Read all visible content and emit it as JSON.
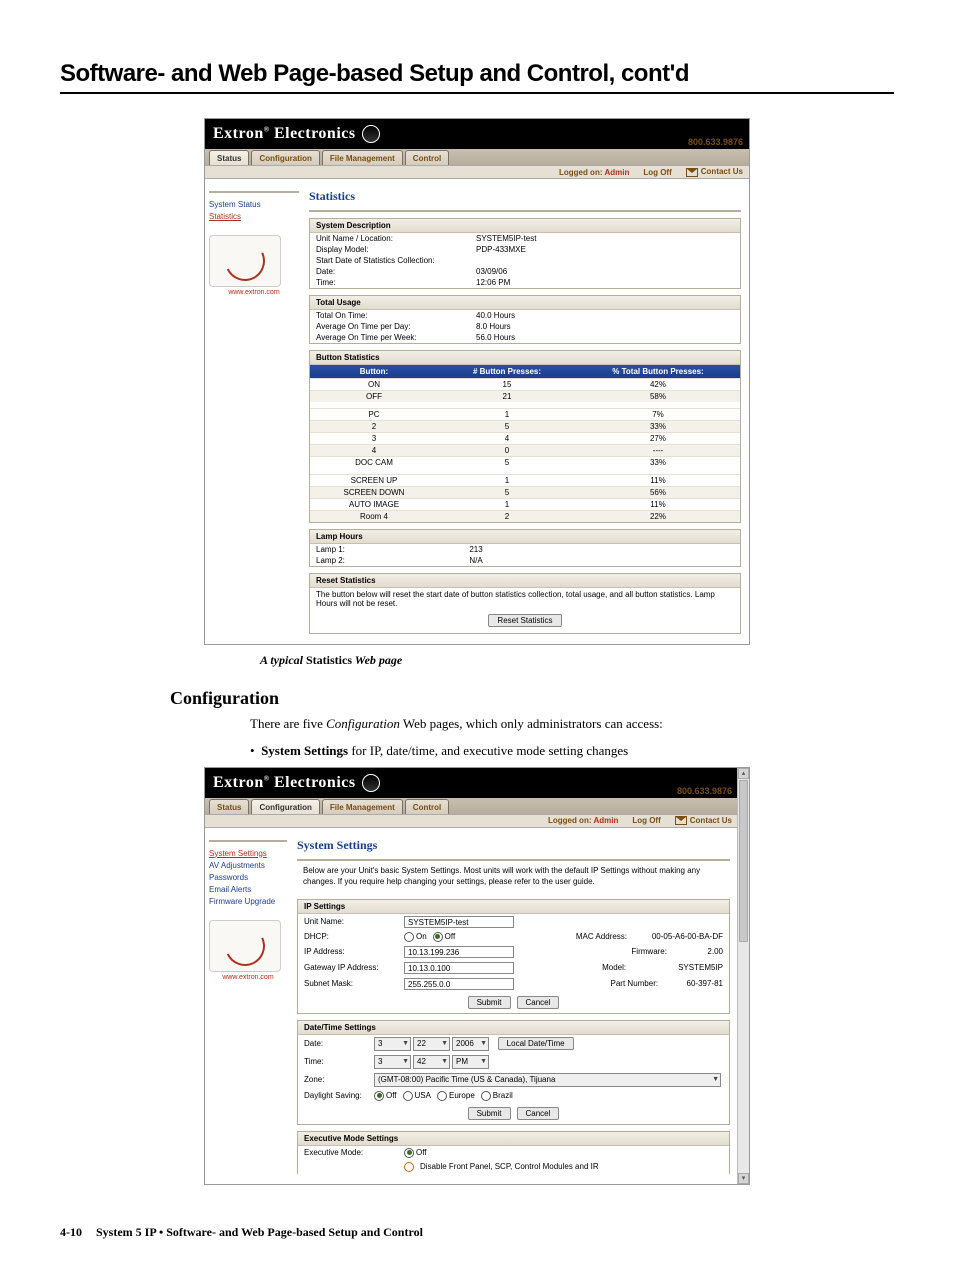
{
  "page": {
    "title": "Software- and Web Page-based Setup and Control, cont'd",
    "footer_page": "4-10",
    "footer_text": "System 5 IP • Software- and Web Page-based Setup and Control"
  },
  "caption1_a": "A typical",
  "caption1_b": "Statistics",
  "caption1_c": "Web page",
  "section_heading": "Configuration",
  "para1_a": "There are five ",
  "para1_ital": "Configuration",
  "para1_b": " Web pages, which only administrators can access:",
  "bullet1_b": "System Settings",
  "bullet1_rest": " for IP, date/time, and executive mode setting changes",
  "brand": {
    "extron": "Extron",
    "electronics": "Electronics",
    "phone": "800.633.9876",
    "logged_label": "Logged on:",
    "logged_user": "Admin",
    "logoff": "Log Off",
    "contact": "Contact Us",
    "url": "www.extron.com"
  },
  "tabs": [
    "Status",
    "Configuration",
    "File Management",
    "Control"
  ],
  "stats": {
    "heading": "Statistics",
    "side_links": [
      "System Status",
      "Statistics"
    ],
    "sys_desc_h": "System Description",
    "sys_desc": {
      "unit_k": "Unit Name / Location:",
      "unit_v": "SYSTEM5IP-test",
      "disp_k": "Display Model:",
      "disp_v": "PDP-433MXE",
      "start_k": "Start Date of Statistics Collection:",
      "start_v": "",
      "date_k": "Date:",
      "date_v": "03/09/06",
      "time_k": "Time:",
      "time_v": "12:06 PM"
    },
    "usage_h": "Total Usage",
    "usage": {
      "tot_k": "Total On Time:",
      "tot_v": "40.0 Hours",
      "day_k": "Average On Time per Day:",
      "day_v": "8.0   Hours",
      "week_k": "Average On Time per Week:",
      "week_v": "56.0 Hours"
    },
    "btn_h": "Button Statistics",
    "btn_cols": {
      "b": "Button:",
      "p": "# Button Presses:",
      "t": "% Total Button Presses:"
    },
    "btn_rows": [
      {
        "b": "ON",
        "p": "15",
        "t": "42%"
      },
      {
        "b": "OFF",
        "p": "21",
        "t": "58%"
      }
    ],
    "btn_rows2": [
      {
        "b": "PC",
        "p": "1",
        "t": "7%"
      },
      {
        "b": "2",
        "p": "5",
        "t": "33%"
      },
      {
        "b": "3",
        "p": "4",
        "t": "27%"
      },
      {
        "b": "4",
        "p": "0",
        "t": "----"
      },
      {
        "b": "DOC CAM",
        "p": "5",
        "t": "33%"
      }
    ],
    "btn_rows3": [
      {
        "b": "SCREEN UP",
        "p": "1",
        "t": "11%"
      },
      {
        "b": "SCREEN DOWN",
        "p": "5",
        "t": "56%"
      },
      {
        "b": "AUTO IMAGE",
        "p": "1",
        "t": "11%"
      },
      {
        "b": "Room 4",
        "p": "2",
        "t": "22%"
      }
    ],
    "lamp_h": "Lamp Hours",
    "lamp": {
      "l1_k": "Lamp 1:",
      "l1_v": "213",
      "l2_k": "Lamp 2:",
      "l2_v": "N/A"
    },
    "reset_h": "Reset Statistics",
    "reset_text": "The button below will reset the start date of button statistics collection, total usage, and all button statistics. Lamp Hours will not be reset.",
    "reset_btn": "Reset Statistics"
  },
  "settings": {
    "heading": "System Settings",
    "side_links": [
      "System Settings",
      "AV Adjustments",
      "Passwords",
      "Email Alerts",
      "Firmware Upgrade"
    ],
    "intro": "Below are your Unit's basic System Settings. Most units will work with the default IP Settings without making any changes. If you require help changing your settings, please refer to the user guide.",
    "ip_h": "IP Settings",
    "ip": {
      "unit_k": "Unit Name:",
      "unit_v": "SYSTEM5IP-test",
      "dhcp_k": "DHCP:",
      "dhcp_on": "On",
      "dhcp_off": "Off",
      "mac_k": "MAC Address:",
      "mac_v": "00-05-A6-00-BA-DF",
      "ipa_k": "IP Address:",
      "ipa_v": "10.13.199.236",
      "fw_k": "Firmware:",
      "fw_v": "2.00",
      "gw_k": "Gateway IP Address:",
      "gw_v": "10.13.0.100",
      "model_k": "Model:",
      "model_v": "SYSTEM5IP",
      "sn_k": "Subnet Mask:",
      "sn_v": "255.255.0.0",
      "part_k": "Part Number:",
      "part_v": "60-397-81"
    },
    "submit": "Submit",
    "cancel": "Cancel",
    "dt_h": "Date/Time Settings",
    "dt": {
      "date_k": "Date:",
      "date_m": "3",
      "date_d": "22",
      "date_y": "2006",
      "local_btn": "Local Date/Time",
      "time_k": "Time:",
      "time_h": "3",
      "time_m": "42",
      "time_ap": "PM",
      "zone_k": "Zone:",
      "zone_v": "(GMT-08:00) Pacific Time (US & Canada), Tijuana",
      "ds_k": "Daylight Saving:",
      "ds_off": "Off",
      "ds_usa": "USA",
      "ds_eu": "Europe",
      "ds_br": "Brazil"
    },
    "exec_h": "Executive Mode Settings",
    "exec": {
      "mode_k": "Executive Mode:",
      "off": "Off",
      "disable": "Disable Front Panel, SCP, Control Modules and IR"
    }
  }
}
